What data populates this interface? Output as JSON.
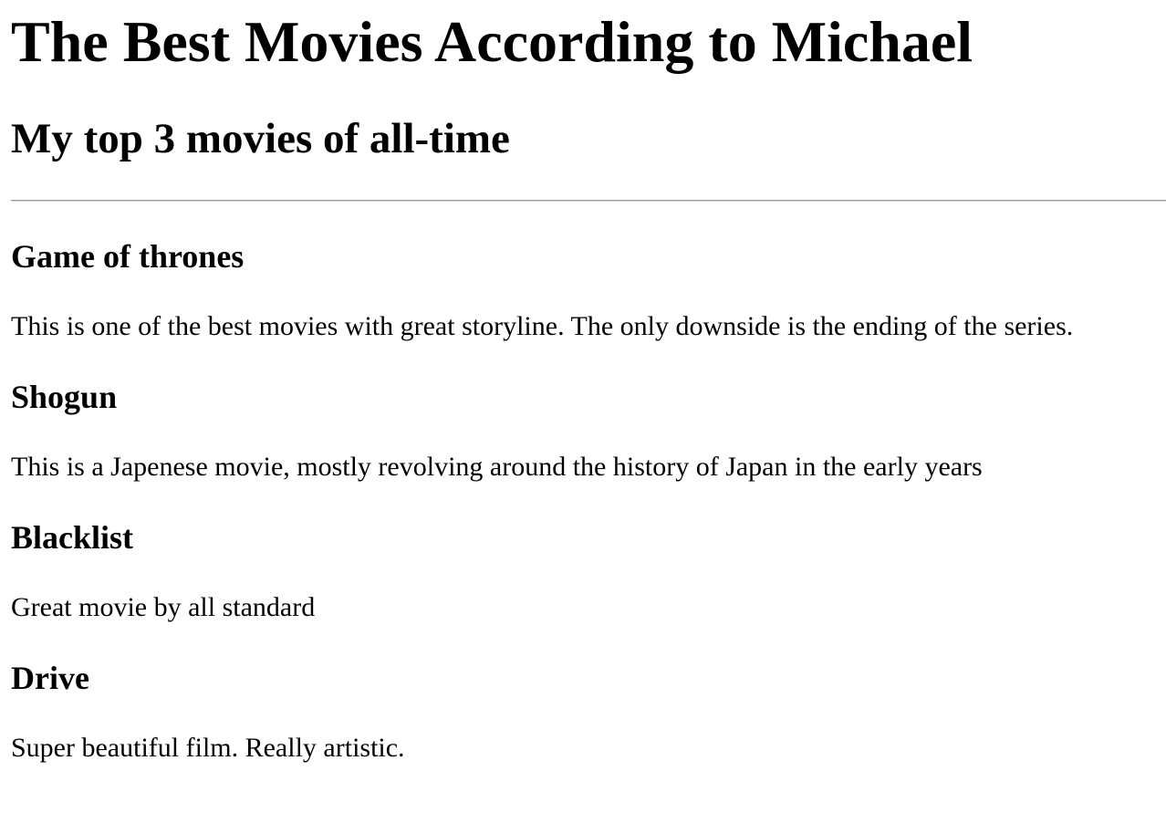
{
  "header": {
    "title": "The Best Movies According to Michael",
    "subtitle": "My top 3 movies of all-time"
  },
  "movies": [
    {
      "title": "Game of thrones",
      "description": "This is one of the best movies with great storyline. The only downside is the ending of the series."
    },
    {
      "title": "Shogun",
      "description": "This is a Japenese movie, mostly revolving around the history of Japan in the early years"
    },
    {
      "title": "Blacklist",
      "description": "Great movie by all standard"
    },
    {
      "title": "Drive",
      "description": "Super beautiful film. Really artistic."
    }
  ]
}
